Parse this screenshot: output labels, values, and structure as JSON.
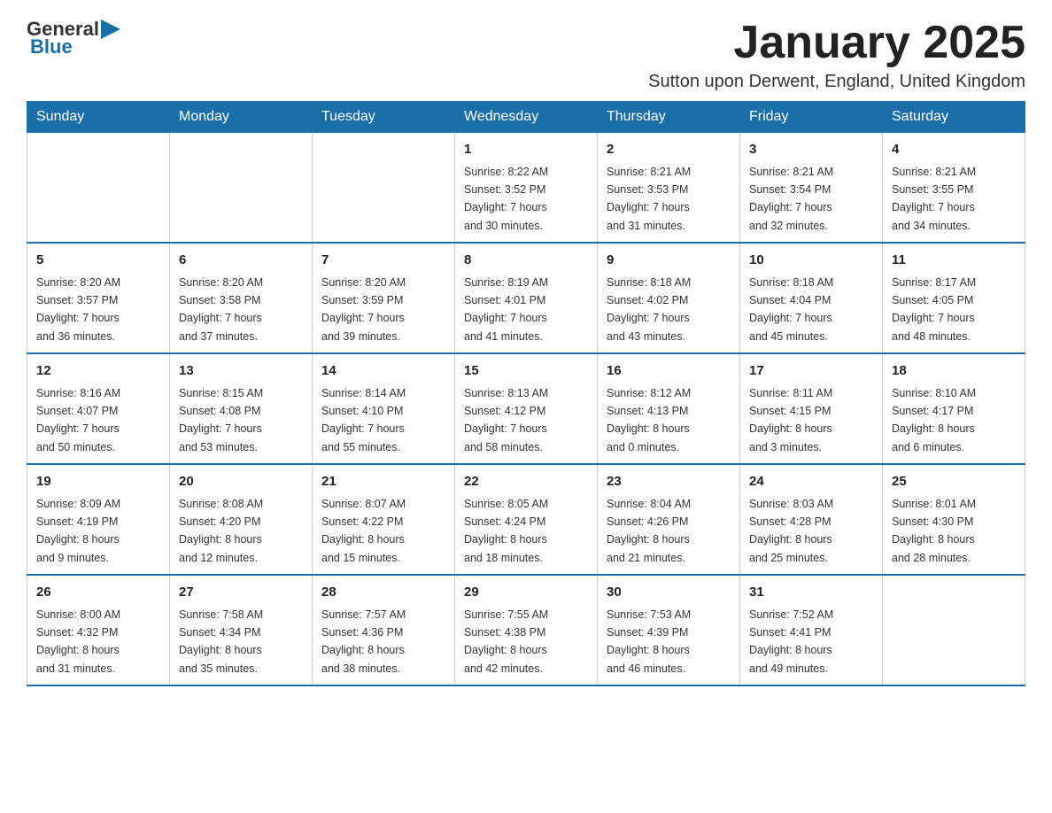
{
  "header": {
    "logo_general": "General",
    "logo_blue": "Blue",
    "month_title": "January 2025",
    "location": "Sutton upon Derwent, England, United Kingdom"
  },
  "weekdays": [
    "Sunday",
    "Monday",
    "Tuesday",
    "Wednesday",
    "Thursday",
    "Friday",
    "Saturday"
  ],
  "weeks": [
    [
      {
        "day": "",
        "info": ""
      },
      {
        "day": "",
        "info": ""
      },
      {
        "day": "",
        "info": ""
      },
      {
        "day": "1",
        "info": "Sunrise: 8:22 AM\nSunset: 3:52 PM\nDaylight: 7 hours\nand 30 minutes."
      },
      {
        "day": "2",
        "info": "Sunrise: 8:21 AM\nSunset: 3:53 PM\nDaylight: 7 hours\nand 31 minutes."
      },
      {
        "day": "3",
        "info": "Sunrise: 8:21 AM\nSunset: 3:54 PM\nDaylight: 7 hours\nand 32 minutes."
      },
      {
        "day": "4",
        "info": "Sunrise: 8:21 AM\nSunset: 3:55 PM\nDaylight: 7 hours\nand 34 minutes."
      }
    ],
    [
      {
        "day": "5",
        "info": "Sunrise: 8:20 AM\nSunset: 3:57 PM\nDaylight: 7 hours\nand 36 minutes."
      },
      {
        "day": "6",
        "info": "Sunrise: 8:20 AM\nSunset: 3:58 PM\nDaylight: 7 hours\nand 37 minutes."
      },
      {
        "day": "7",
        "info": "Sunrise: 8:20 AM\nSunset: 3:59 PM\nDaylight: 7 hours\nand 39 minutes."
      },
      {
        "day": "8",
        "info": "Sunrise: 8:19 AM\nSunset: 4:01 PM\nDaylight: 7 hours\nand 41 minutes."
      },
      {
        "day": "9",
        "info": "Sunrise: 8:18 AM\nSunset: 4:02 PM\nDaylight: 7 hours\nand 43 minutes."
      },
      {
        "day": "10",
        "info": "Sunrise: 8:18 AM\nSunset: 4:04 PM\nDaylight: 7 hours\nand 45 minutes."
      },
      {
        "day": "11",
        "info": "Sunrise: 8:17 AM\nSunset: 4:05 PM\nDaylight: 7 hours\nand 48 minutes."
      }
    ],
    [
      {
        "day": "12",
        "info": "Sunrise: 8:16 AM\nSunset: 4:07 PM\nDaylight: 7 hours\nand 50 minutes."
      },
      {
        "day": "13",
        "info": "Sunrise: 8:15 AM\nSunset: 4:08 PM\nDaylight: 7 hours\nand 53 minutes."
      },
      {
        "day": "14",
        "info": "Sunrise: 8:14 AM\nSunset: 4:10 PM\nDaylight: 7 hours\nand 55 minutes."
      },
      {
        "day": "15",
        "info": "Sunrise: 8:13 AM\nSunset: 4:12 PM\nDaylight: 7 hours\nand 58 minutes."
      },
      {
        "day": "16",
        "info": "Sunrise: 8:12 AM\nSunset: 4:13 PM\nDaylight: 8 hours\nand 0 minutes."
      },
      {
        "day": "17",
        "info": "Sunrise: 8:11 AM\nSunset: 4:15 PM\nDaylight: 8 hours\nand 3 minutes."
      },
      {
        "day": "18",
        "info": "Sunrise: 8:10 AM\nSunset: 4:17 PM\nDaylight: 8 hours\nand 6 minutes."
      }
    ],
    [
      {
        "day": "19",
        "info": "Sunrise: 8:09 AM\nSunset: 4:19 PM\nDaylight: 8 hours\nand 9 minutes."
      },
      {
        "day": "20",
        "info": "Sunrise: 8:08 AM\nSunset: 4:20 PM\nDaylight: 8 hours\nand 12 minutes."
      },
      {
        "day": "21",
        "info": "Sunrise: 8:07 AM\nSunset: 4:22 PM\nDaylight: 8 hours\nand 15 minutes."
      },
      {
        "day": "22",
        "info": "Sunrise: 8:05 AM\nSunset: 4:24 PM\nDaylight: 8 hours\nand 18 minutes."
      },
      {
        "day": "23",
        "info": "Sunrise: 8:04 AM\nSunset: 4:26 PM\nDaylight: 8 hours\nand 21 minutes."
      },
      {
        "day": "24",
        "info": "Sunrise: 8:03 AM\nSunset: 4:28 PM\nDaylight: 8 hours\nand 25 minutes."
      },
      {
        "day": "25",
        "info": "Sunrise: 8:01 AM\nSunset: 4:30 PM\nDaylight: 8 hours\nand 28 minutes."
      }
    ],
    [
      {
        "day": "26",
        "info": "Sunrise: 8:00 AM\nSunset: 4:32 PM\nDaylight: 8 hours\nand 31 minutes."
      },
      {
        "day": "27",
        "info": "Sunrise: 7:58 AM\nSunset: 4:34 PM\nDaylight: 8 hours\nand 35 minutes."
      },
      {
        "day": "28",
        "info": "Sunrise: 7:57 AM\nSunset: 4:36 PM\nDaylight: 8 hours\nand 38 minutes."
      },
      {
        "day": "29",
        "info": "Sunrise: 7:55 AM\nSunset: 4:38 PM\nDaylight: 8 hours\nand 42 minutes."
      },
      {
        "day": "30",
        "info": "Sunrise: 7:53 AM\nSunset: 4:39 PM\nDaylight: 8 hours\nand 46 minutes."
      },
      {
        "day": "31",
        "info": "Sunrise: 7:52 AM\nSunset: 4:41 PM\nDaylight: 8 hours\nand 49 minutes."
      },
      {
        "day": "",
        "info": ""
      }
    ]
  ]
}
